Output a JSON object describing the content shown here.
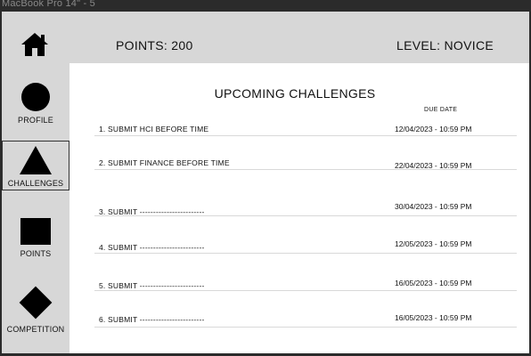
{
  "window": {
    "frame_label": "MacBook Pro 14\" - 5"
  },
  "header": {
    "points": "POINTS: 200",
    "level": "LEVEL: NOVICE",
    "home_icon": "home-icon"
  },
  "sidebar": {
    "items": [
      {
        "label": "PROFILE",
        "icon": "circle-icon",
        "active": false
      },
      {
        "label": "CHALLENGES",
        "icon": "triangle-icon",
        "active": true
      },
      {
        "label": "POINTS",
        "icon": "square-icon",
        "active": false
      },
      {
        "label": "COMPETITION",
        "icon": "diamond-icon",
        "active": false
      }
    ]
  },
  "main": {
    "title": "UPCOMING CHALLENGES",
    "due_header": "DUE DATE",
    "challenges": [
      {
        "task": "1. SUBMIT HCI BEFORE TIME",
        "due": "12/04/2023 - 10:59 PM"
      },
      {
        "task": "2. SUBMIT FINANCE BEFORE TIME",
        "due": "22/04/2023 - 10:59 PM"
      },
      {
        "task": "3. SUBMIT  ------------------------",
        "due": "30/04/2023 - 10:59 PM"
      },
      {
        "task": "4. SUBMIT  ------------------------",
        "due": "12/05/2023 - 10:59 PM"
      },
      {
        "task": "5. SUBMIT  ------------------------",
        "due": "16/05/2023 - 10:59 PM"
      },
      {
        "task": "6. SUBMIT  ------------------------",
        "due": "16/05/2023 - 10:59 PM"
      }
    ]
  },
  "colors": {
    "sidebar_bg": "#d7d7d7",
    "content_bg": "#ffffff",
    "frame_bg": "#2b2b2b"
  }
}
